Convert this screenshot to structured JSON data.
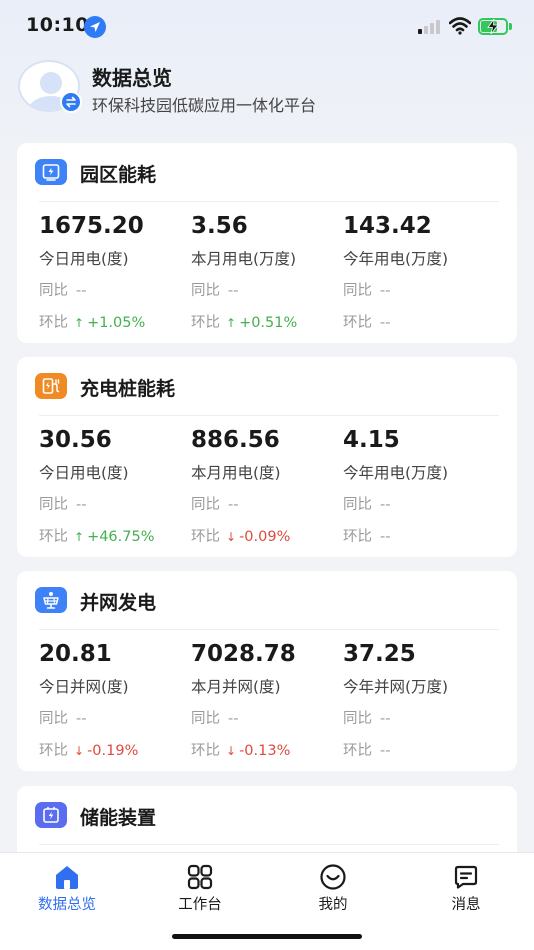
{
  "status_bar": {
    "time": "10:10"
  },
  "header": {
    "title": "数据总览",
    "subtitle": "环保科技园低碳应用一体化平台"
  },
  "labels": {
    "yoy": "同比",
    "mom": "环比"
  },
  "cards": [
    {
      "title": "园区能耗",
      "icon": "building-power-icon",
      "color": "#3d82f7",
      "metrics": [
        {
          "value": "1675.20",
          "label": "今日用电(度)",
          "yoy": "--",
          "mom": "+1.05%",
          "mom_dir": "up"
        },
        {
          "value": "3.56",
          "label": "本月用电(万度)",
          "yoy": "--",
          "mom": "+0.51%",
          "mom_dir": "up"
        },
        {
          "value": "143.42",
          "label": "今年用电(万度)",
          "yoy": "--",
          "mom": "--",
          "mom_dir": "none"
        }
      ]
    },
    {
      "title": "充电桩能耗",
      "icon": "charging-pile-icon",
      "color": "#f08a24",
      "metrics": [
        {
          "value": "30.56",
          "label": "今日用电(度)",
          "yoy": "--",
          "mom": "+46.75%",
          "mom_dir": "up"
        },
        {
          "value": "886.56",
          "label": "本月用电(度)",
          "yoy": "--",
          "mom": "-0.09%",
          "mom_dir": "down"
        },
        {
          "value": "4.15",
          "label": "今年用电(万度)",
          "yoy": "--",
          "mom": "--",
          "mom_dir": "none"
        }
      ]
    },
    {
      "title": "并网发电",
      "icon": "solar-panel-icon",
      "color": "#3d82f7",
      "metrics": [
        {
          "value": "20.81",
          "label": "今日并网(度)",
          "yoy": "--",
          "mom": "-0.19%",
          "mom_dir": "down"
        },
        {
          "value": "7028.78",
          "label": "本月并网(度)",
          "yoy": "--",
          "mom": "-0.13%",
          "mom_dir": "down"
        },
        {
          "value": "37.25",
          "label": "今年并网(万度)",
          "yoy": "--",
          "mom": "--",
          "mom_dir": "none"
        }
      ]
    },
    {
      "title": "储能装置",
      "icon": "battery-storage-icon",
      "color": "#5a6cf0",
      "metrics": []
    }
  ],
  "tabs": [
    {
      "label": "数据总览",
      "icon": "home-icon",
      "active": true
    },
    {
      "label": "工作台",
      "icon": "grid-icon",
      "active": false
    },
    {
      "label": "我的",
      "icon": "smile-icon",
      "active": false
    },
    {
      "label": "消息",
      "icon": "message-icon",
      "active": false
    }
  ]
}
